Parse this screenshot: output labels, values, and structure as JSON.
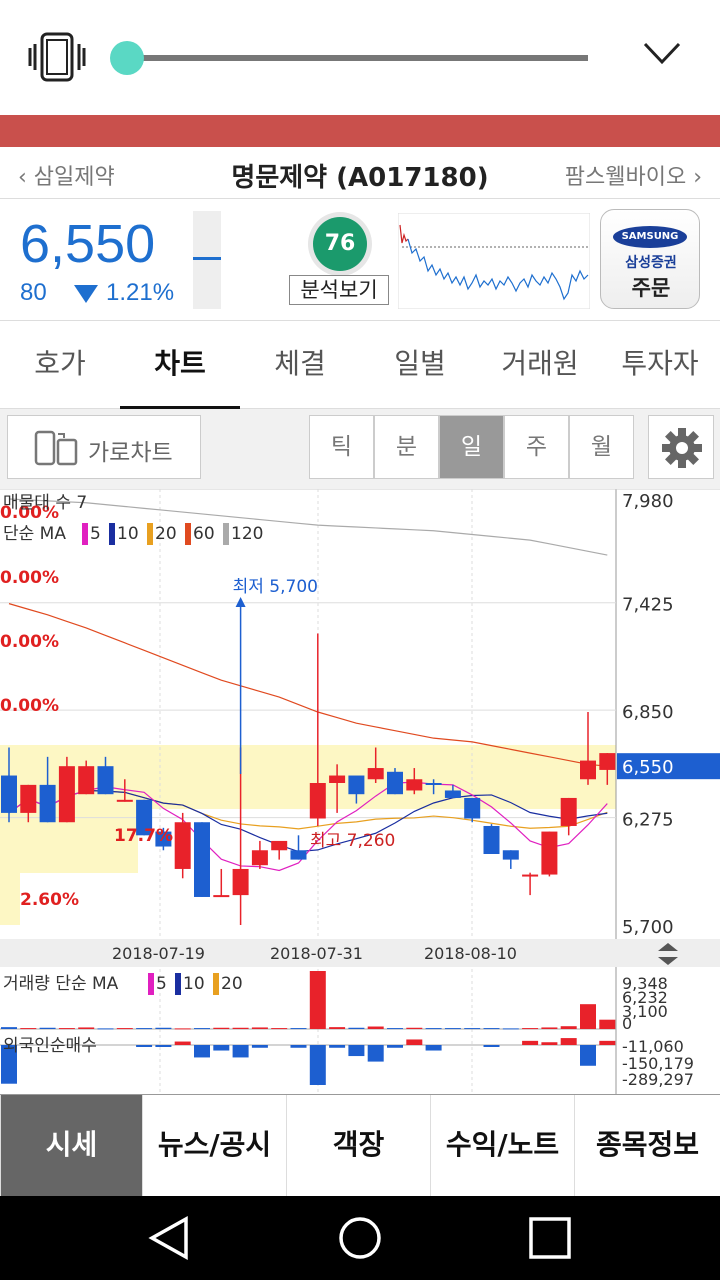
{
  "status": {
    "vibrate_icon": "vibrate-icon",
    "collapse_icon": "chevron-down-icon",
    "volume": 0.0
  },
  "nav": {
    "prev": "삼일제약",
    "title": "명문제약 (A017180)",
    "next": "팜스웰바이오"
  },
  "quote": {
    "price": "6,550",
    "change": "80",
    "change_pct": "1.21%",
    "score": "76",
    "analysis_label": "분석보기",
    "broker_logo": "SAMSUNG",
    "broker_name": "삼성증권",
    "order_label": "주문"
  },
  "tabs": [
    "호가",
    "차트",
    "체결",
    "일별",
    "거래원",
    "투자자"
  ],
  "toolbar": {
    "landscape_label": "가로차트",
    "periods": [
      "틱",
      "분",
      "일",
      "주",
      "월"
    ],
    "active_period": "일"
  },
  "chart_data": {
    "type": "candlestick",
    "labels": {
      "supply_band": "매물대 수 7",
      "ma_label": "단순 MA",
      "ma_periods": [
        "5",
        "10",
        "20",
        "60",
        "120"
      ],
      "low_annotation": "최저 5,700",
      "high_annotation": "최고 7,260",
      "pct_labels": [
        "0.00%",
        "0.00%",
        "0.00%",
        "0.00%",
        "17.7%",
        "2.60%"
      ]
    },
    "colors": {
      "up": "#e8222a",
      "down": "#1d5fd0",
      "ma5": "#e020c0",
      "ma10": "#1a2ea0",
      "ma20": "#e8a020",
      "ma60": "#e04a20",
      "ma120": "#aaaaaa"
    },
    "y_ticks": [
      "7,980",
      "7,425",
      "6,850",
      "6,550",
      "6,275",
      "5,700"
    ],
    "ylim": [
      5700,
      7980
    ],
    "x_ticks": [
      "2018-07-19",
      "2018-07-31",
      "2018-08-10"
    ],
    "candles": [
      {
        "o": 6500,
        "h": 6650,
        "l": 6250,
        "c": 6300
      },
      {
        "o": 6300,
        "h": 6450,
        "l": 6250,
        "c": 6450
      },
      {
        "o": 6450,
        "h": 6600,
        "l": 6250,
        "c": 6250
      },
      {
        "o": 6250,
        "h": 6600,
        "l": 6250,
        "c": 6550
      },
      {
        "o": 6400,
        "h": 6580,
        "l": 6400,
        "c": 6550
      },
      {
        "o": 6550,
        "h": 6600,
        "l": 6400,
        "c": 6400
      },
      {
        "o": 6370,
        "h": 6480,
        "l": 6360,
        "c": 6370
      },
      {
        "o": 6370,
        "h": 6370,
        "l": 6180,
        "c": 6180
      },
      {
        "o": 6200,
        "h": 6220,
        "l": 6100,
        "c": 6120
      },
      {
        "o": 6000,
        "h": 6300,
        "l": 5950,
        "c": 6250
      },
      {
        "o": 6250,
        "h": 6250,
        "l": 5850,
        "c": 5850
      },
      {
        "o": 5850,
        "h": 6000,
        "l": 5850,
        "c": 5860
      },
      {
        "o": 5860,
        "h": 6650,
        "l": 5700,
        "c": 6000
      },
      {
        "o": 6020,
        "h": 6150,
        "l": 6000,
        "c": 6100
      },
      {
        "o": 6100,
        "h": 6120,
        "l": 6050,
        "c": 6150
      },
      {
        "o": 6100,
        "h": 6180,
        "l": 6050,
        "c": 6050
      },
      {
        "o": 6270,
        "h": 7260,
        "l": 6230,
        "c": 6460
      },
      {
        "o": 6460,
        "h": 6560,
        "l": 6300,
        "c": 6500
      },
      {
        "o": 6500,
        "h": 6480,
        "l": 6350,
        "c": 6400
      },
      {
        "o": 6480,
        "h": 6650,
        "l": 6460,
        "c": 6540
      },
      {
        "o": 6520,
        "h": 6540,
        "l": 6400,
        "c": 6400
      },
      {
        "o": 6420,
        "h": 6540,
        "l": 6400,
        "c": 6480
      },
      {
        "o": 6460,
        "h": 6480,
        "l": 6400,
        "c": 6450
      },
      {
        "o": 6420,
        "h": 6450,
        "l": 6380,
        "c": 6380
      },
      {
        "o": 6380,
        "h": 6380,
        "l": 6250,
        "c": 6270
      },
      {
        "o": 6230,
        "h": 6240,
        "l": 6080,
        "c": 6080
      },
      {
        "o": 6100,
        "h": 6100,
        "l": 6000,
        "c": 6050
      },
      {
        "o": 5960,
        "h": 5980,
        "l": 5860,
        "c": 5970
      },
      {
        "o": 5970,
        "h": 6200,
        "l": 5960,
        "c": 6200
      },
      {
        "o": 6230,
        "h": 6380,
        "l": 6180,
        "c": 6380
      },
      {
        "o": 6480,
        "h": 6840,
        "l": 6450,
        "c": 6580
      },
      {
        "o": 6530,
        "h": 6620,
        "l": 6450,
        "c": 6620
      }
    ],
    "ma60": [
      7420,
      7390,
      7360,
      7325,
      7290,
      7250,
      7210,
      7170,
      7130,
      7090,
      7050,
      7010,
      6980,
      6950,
      6920,
      6880,
      6840,
      6810,
      6780,
      6760,
      6740,
      6720,
      6700,
      6690,
      6680,
      6660,
      6640,
      6620,
      6600,
      6580,
      6560,
      6550
    ],
    "ma120": [
      7980,
      7975,
      7970,
      7965,
      7960,
      7950,
      7940,
      7930,
      7920,
      7910,
      7900,
      7890,
      7880,
      7870,
      7860,
      7850,
      7840,
      7835,
      7830,
      7825,
      7820,
      7815,
      7810,
      7800,
      7790,
      7780,
      7770,
      7760,
      7740,
      7720,
      7700,
      7680
    ],
    "volume": {
      "label": "거래량 단순 MA",
      "ma_periods": [
        "5",
        "10",
        "20"
      ],
      "ticks": [
        "9,348",
        "6,232",
        "3,100",
        "0"
      ],
      "values": [
        300,
        150,
        200,
        150,
        250,
        100,
        150,
        150,
        200,
        100,
        150,
        200,
        200,
        250,
        150,
        150,
        9348,
        300,
        200,
        400,
        150,
        200,
        150,
        150,
        150,
        150,
        100,
        150,
        250,
        450,
        4000,
        1500
      ]
    },
    "foreign": {
      "label": "외국인순매수",
      "ticks": [
        "-11,060",
        "-150,179",
        "-289,297"
      ],
      "values": [
        -280000,
        0,
        0,
        0,
        0,
        0,
        0,
        -10000,
        -5000,
        25000,
        -90000,
        -40000,
        -90000,
        -20000,
        0,
        -20000,
        -289297,
        -20000,
        -80000,
        -120000,
        -20000,
        40000,
        -40000,
        0,
        0,
        -5000,
        0,
        30000,
        20000,
        50000,
        -150179,
        30000
      ]
    }
  },
  "bottom_nav": [
    "시세",
    "뉴스/공시",
    "객장",
    "수익/노트",
    "종목정보"
  ],
  "system_nav": {
    "back": "back-icon",
    "home": "home-icon",
    "recents": "recents-icon"
  }
}
